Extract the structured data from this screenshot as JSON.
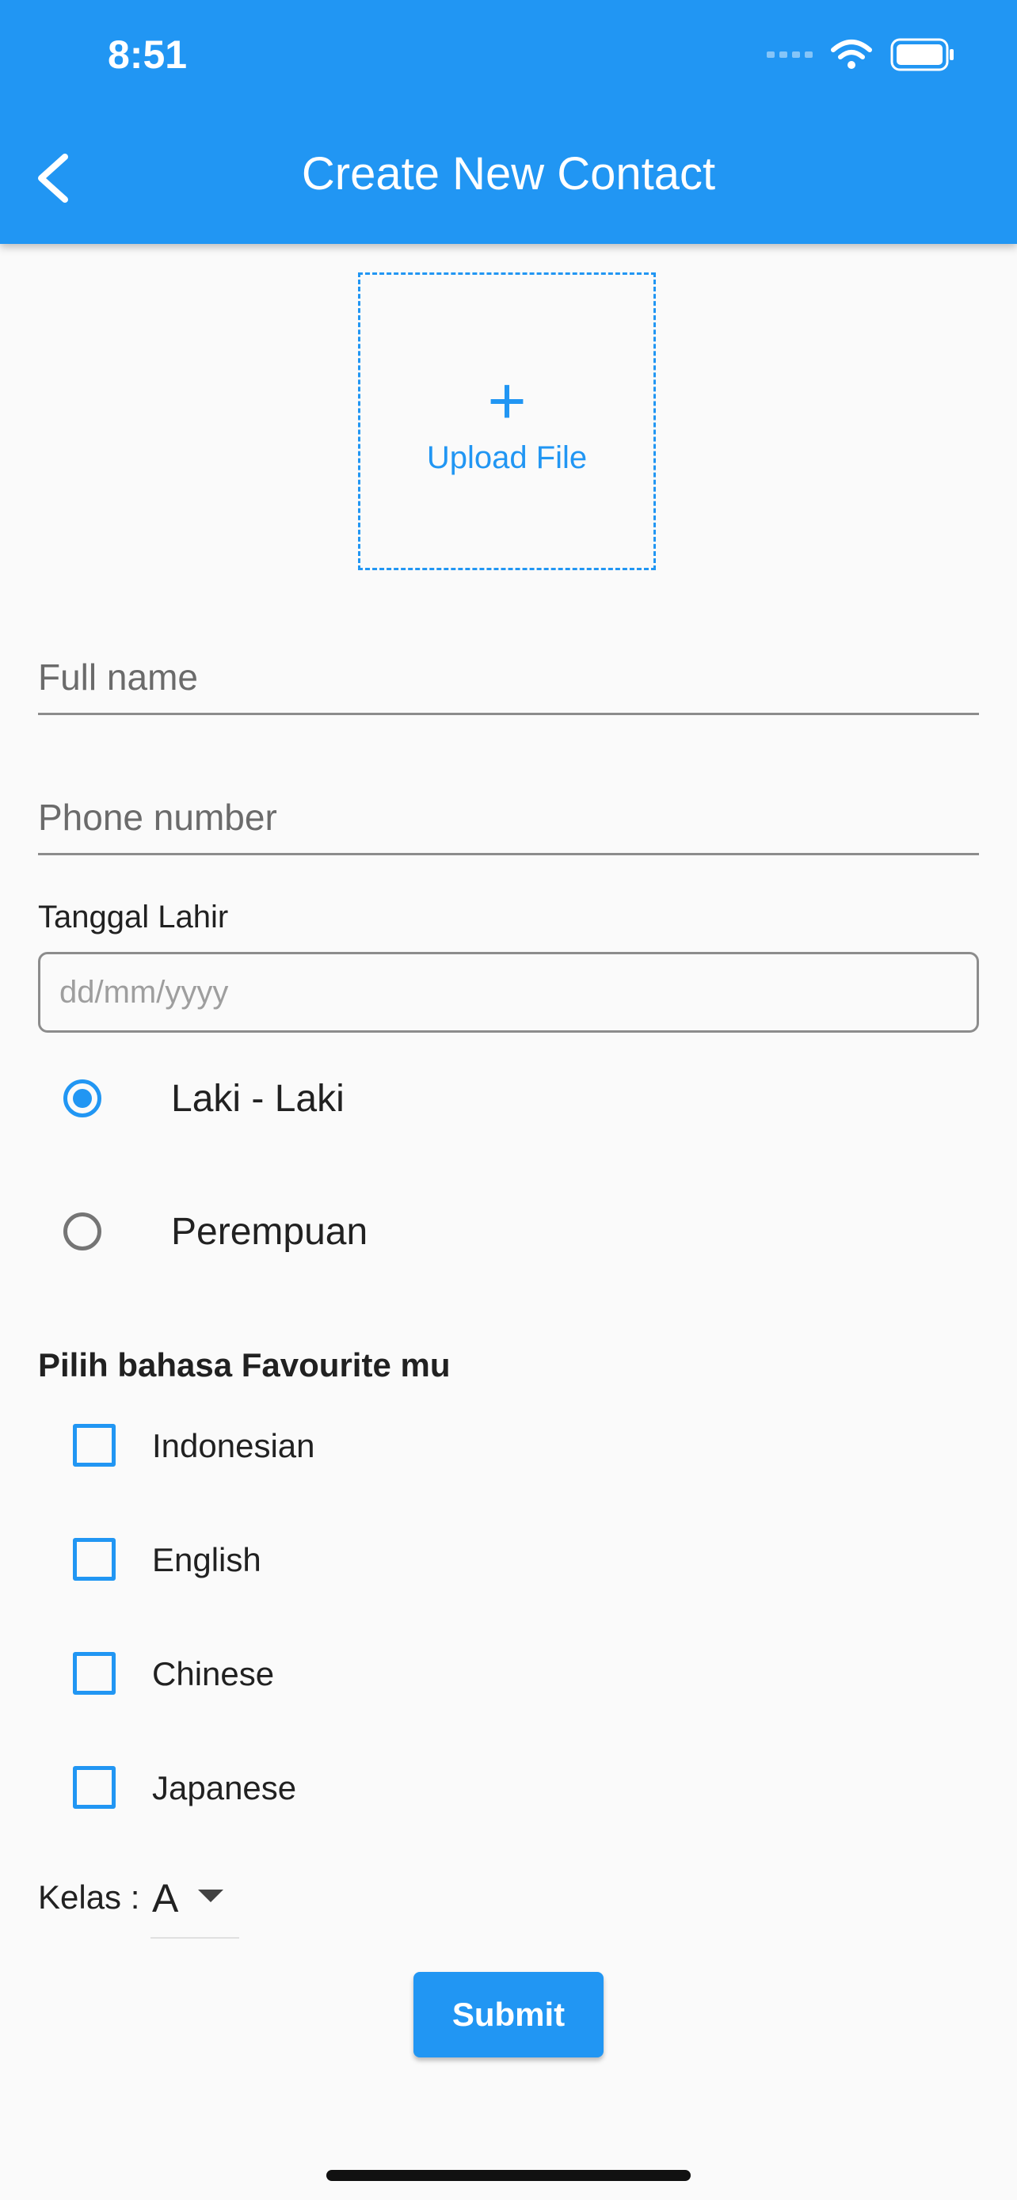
{
  "status_bar": {
    "time": "8:51"
  },
  "app_bar": {
    "title": "Create New Contact",
    "back_icon": "chevron-left-icon",
    "color": "#2196f3"
  },
  "upload": {
    "plus": "+",
    "label": "Upload File"
  },
  "form": {
    "full_name": {
      "value": "",
      "placeholder": "Full name"
    },
    "phone": {
      "value": "",
      "placeholder": "Phone number"
    },
    "birth_date": {
      "label": "Tanggal Lahir",
      "value": "",
      "placeholder": "dd/mm/yyyy"
    },
    "gender": {
      "options": [
        {
          "label": "Laki - Laki",
          "selected": true
        },
        {
          "label": "Perempuan",
          "selected": false
        }
      ]
    },
    "languages": {
      "title": "Pilih bahasa Favourite mu",
      "options": [
        {
          "label": "Indonesian",
          "checked": false
        },
        {
          "label": "English",
          "checked": false
        },
        {
          "label": "Chinese",
          "checked": false
        },
        {
          "label": "Japanese",
          "checked": false
        }
      ]
    },
    "kelas": {
      "label": "Kelas :",
      "value": "A"
    },
    "submit_label": "Submit"
  }
}
